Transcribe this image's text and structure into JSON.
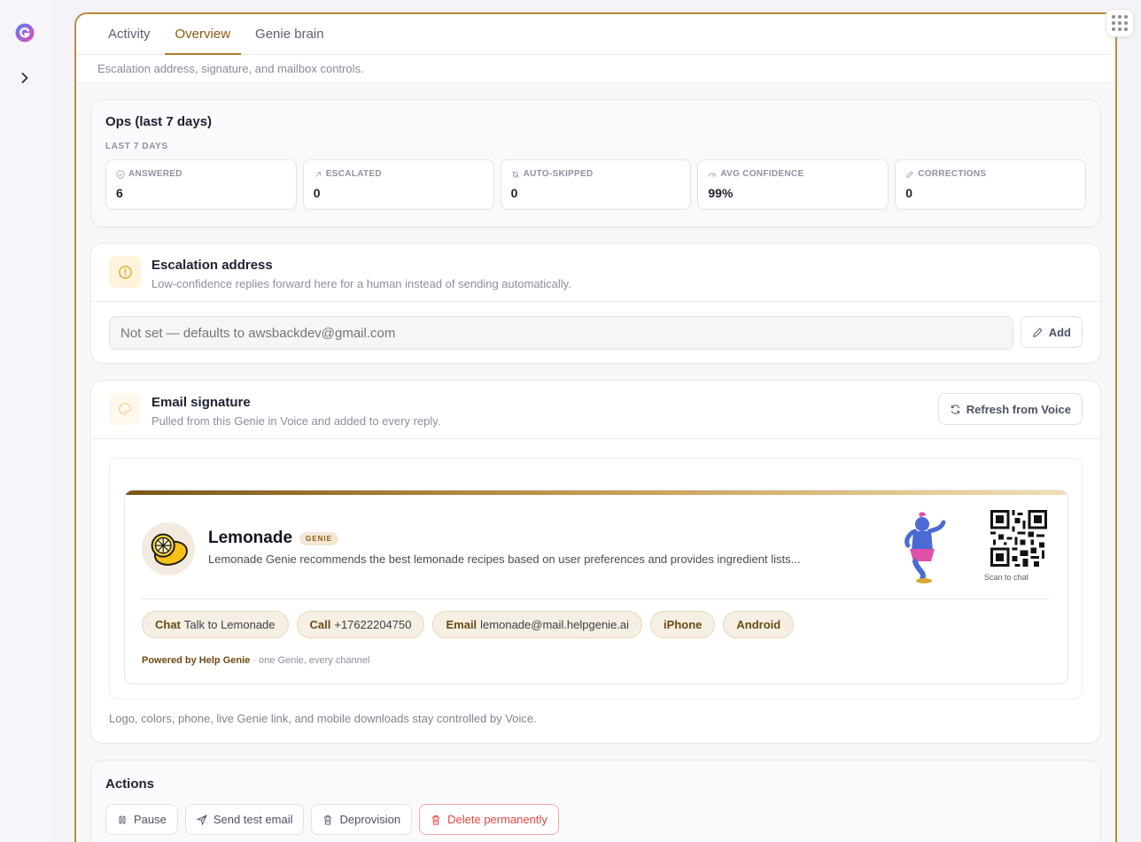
{
  "tabs": [
    {
      "label": "Activity"
    },
    {
      "label": "Overview"
    },
    {
      "label": "Genie brain"
    }
  ],
  "subtitle": "Escalation address, signature, and mailbox controls.",
  "ops": {
    "title": "Ops (last 7 days)",
    "caption": "LAST 7 DAYS",
    "stats": [
      {
        "label": "ANSWERED",
        "value": "6",
        "icon": "check-circle-icon"
      },
      {
        "label": "ESCALATED",
        "value": "0",
        "icon": "arrow-up-right-icon"
      },
      {
        "label": "AUTO-SKIPPED",
        "value": "0",
        "icon": "bell-off-icon"
      },
      {
        "label": "AVG CONFIDENCE",
        "value": "99%",
        "icon": "gauge-icon"
      },
      {
        "label": "CORRECTIONS",
        "value": "0",
        "icon": "pencil-icon"
      }
    ]
  },
  "escalation": {
    "title": "Escalation address",
    "description": "Low-confidence replies forward here for a human instead of sending automatically.",
    "placeholder": "Not set — defaults to awsbackdev@gmail.com",
    "add_label": "Add"
  },
  "signature": {
    "title": "Email signature",
    "description": "Pulled from this Genie in Voice and added to every reply.",
    "refresh_label": "Refresh from Voice",
    "name": "Lemonade",
    "badge": "GENIE",
    "tagline": "Lemonade Genie recommends the best lemonade recipes based on user preferences and provides ingredient lists...",
    "qr_label": "Scan to chat",
    "chips": [
      {
        "key": "Chat",
        "value": "Talk to Lemonade"
      },
      {
        "key": "Call",
        "value": "+17622204750"
      },
      {
        "key": "Email",
        "value": "lemonade@mail.helpgenie.ai"
      },
      {
        "key": "iPhone",
        "value": ""
      },
      {
        "key": "Android",
        "value": ""
      }
    ],
    "powered_brand": "Powered by Help Genie",
    "powered_rest": " · one Genie, every channel",
    "footer": "Logo, colors, phone, live Genie link, and mobile downloads stay controlled by Voice."
  },
  "actions": {
    "title": "Actions",
    "buttons": [
      {
        "label": "Pause"
      },
      {
        "label": "Send test email"
      },
      {
        "label": "Deprovision"
      },
      {
        "label": "Delete permanently"
      }
    ]
  },
  "colors": {
    "accent": "#b07a2a",
    "danger": "#e0453f"
  }
}
